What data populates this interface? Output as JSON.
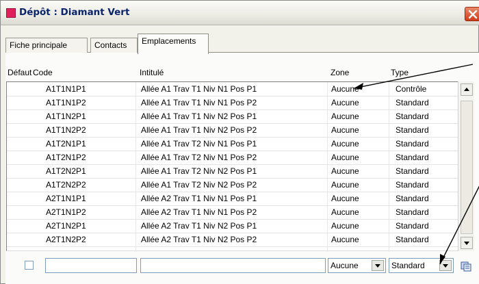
{
  "window": {
    "title": "Dépôt : Diamant Vert"
  },
  "tabs": [
    {
      "label": "Fiche principale"
    },
    {
      "label": "Contacts"
    },
    {
      "label": "Emplacements"
    }
  ],
  "columns": {
    "default": "Défaut",
    "code": "Code",
    "label": "Intitulé",
    "zone": "Zone",
    "type": "Type"
  },
  "rows": [
    {
      "code": "A1T1N1P1",
      "label": "Allée A1 Trav T1 Niv N1 Pos P1",
      "zone": "Aucune",
      "type": "Contrôle"
    },
    {
      "code": "A1T1N1P2",
      "label": "Allée A1 Trav T1 Niv N1 Pos P2",
      "zone": "Aucune",
      "type": "Standard"
    },
    {
      "code": "A1T1N2P1",
      "label": "Allée A1 Trav T1 Niv N2 Pos P1",
      "zone": "Aucune",
      "type": "Standard"
    },
    {
      "code": "A1T1N2P2",
      "label": "Allée A1 Trav T1 Niv N2 Pos P2",
      "zone": "Aucune",
      "type": "Standard"
    },
    {
      "code": "A1T2N1P1",
      "label": "Allée A1 Trav T2 Niv N1 Pos P1",
      "zone": "Aucune",
      "type": "Standard"
    },
    {
      "code": "A1T2N1P2",
      "label": "Allée A1 Trav T2 Niv N1 Pos P2",
      "zone": "Aucune",
      "type": "Standard"
    },
    {
      "code": "A1T2N2P1",
      "label": "Allée A1 Trav T2 Niv N2 Pos P1",
      "zone": "Aucune",
      "type": "Standard"
    },
    {
      "code": "A1T2N2P2",
      "label": "Allée A1 Trav T2 Niv N2 Pos P2",
      "zone": "Aucune",
      "type": "Standard"
    },
    {
      "code": "A2T1N1P1",
      "label": "Allée A2 Trav T1 Niv N1 Pos P1",
      "zone": "Aucune",
      "type": "Standard"
    },
    {
      "code": "A2T1N1P2",
      "label": "Allée A2 Trav T1 Niv N1 Pos P2",
      "zone": "Aucune",
      "type": "Standard"
    },
    {
      "code": "A2T1N2P1",
      "label": "Allée A2 Trav T1 Niv N2 Pos P1",
      "zone": "Aucune",
      "type": "Standard"
    },
    {
      "code": "A2T1N2P2",
      "label": "Allée A2 Trav T1 Niv N2 Pos P2",
      "zone": "Aucune",
      "type": "Standard"
    }
  ],
  "editor": {
    "default_checked": false,
    "code_value": "",
    "label_value": "",
    "zone_value": "Aucune",
    "type_value": "Standard"
  },
  "colors": {
    "title_text": "#0a246a",
    "app_icon": "#e0205a",
    "close_button": "#cf3b1a",
    "row_separator": "#e4e4e4"
  },
  "icons": {
    "app": "app-icon",
    "close": "close-icon",
    "scroll_up": "scroll-up-arrow-icon",
    "scroll_down": "scroll-down-arrow-icon",
    "dropdown": "chevron-down-icon",
    "action": "copy-icon"
  }
}
